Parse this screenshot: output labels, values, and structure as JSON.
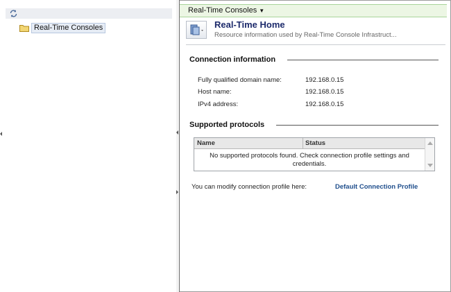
{
  "left": {
    "tree_root_label": "Real-Time Consoles"
  },
  "nav": {
    "menu_label": "Real-Time Consoles"
  },
  "header": {
    "title": "Real-Time Home",
    "subtitle": "Resource information used by Real-Time Console Infrastruct..."
  },
  "connection": {
    "title": "Connection information",
    "rows": [
      {
        "label": "Fully qualified domain name:",
        "value": "192.168.0.15"
      },
      {
        "label": "Host name:",
        "value": "192.168.0.15"
      },
      {
        "label": "IPv4 address:",
        "value": "192.168.0.15"
      }
    ]
  },
  "protocols": {
    "title": "Supported protocols",
    "columns": [
      "Name",
      "Status"
    ],
    "empty_message": "No supported protocols found. Check connection profile settings and credentials."
  },
  "footer": {
    "text": "You can modify connection profile here:",
    "link": "Default Connection Profile"
  },
  "colors": {
    "title_blue": "#1c2a6b",
    "link_blue": "#1f4e8c",
    "nav_green_bg": "#ecf6e4"
  },
  "icons": [
    "refresh-icon",
    "folder-icon",
    "home-resource-icon",
    "chevron-down-icon"
  ]
}
